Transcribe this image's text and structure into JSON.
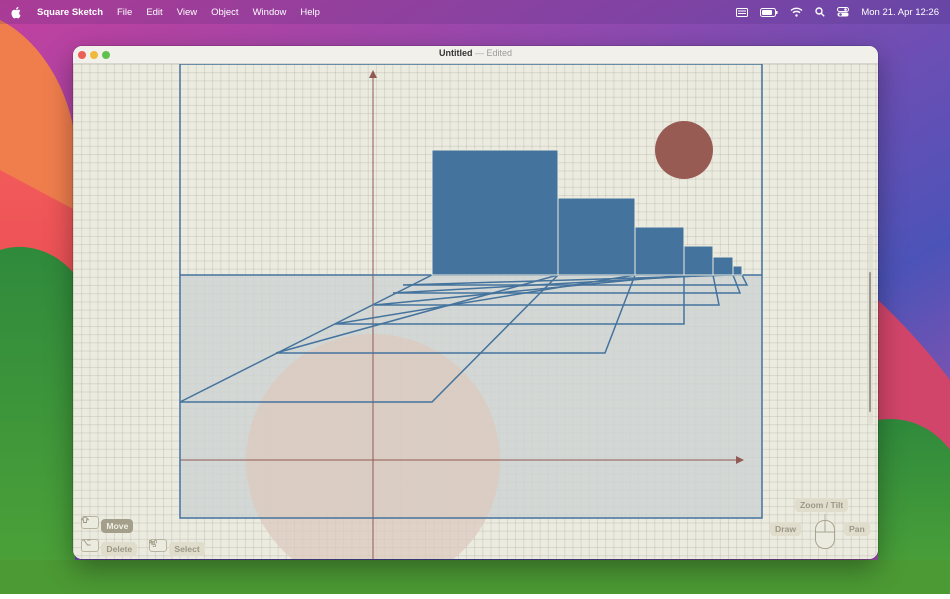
{
  "menubar": {
    "app_name": "Square Sketch",
    "items": [
      "File",
      "Edit",
      "View",
      "Object",
      "Window",
      "Help"
    ],
    "clock": "Mon 21. Apr  12:26"
  },
  "window": {
    "title": "Untitled",
    "separator": "—",
    "status": "Edited"
  },
  "hints": {
    "move_key_icon": "shift-key-icon",
    "move_label": "Move",
    "delete_key_icon": "option-key-icon",
    "delete_label": "Delete",
    "select_key_icon": "command-key-icon",
    "select_label": "Select",
    "mouse_top_label": "Zoom / Tilt",
    "mouse_left_label": "Draw",
    "mouse_right_label": "Pan"
  },
  "colors": {
    "square_fill": "#44739d",
    "sun_fill": "#985b54",
    "axis": "#915a55",
    "frame": "#44739d",
    "ground": "#cfd3d2",
    "disc": "#dcc9bd",
    "canvas_bg": "#ecebe0"
  }
}
